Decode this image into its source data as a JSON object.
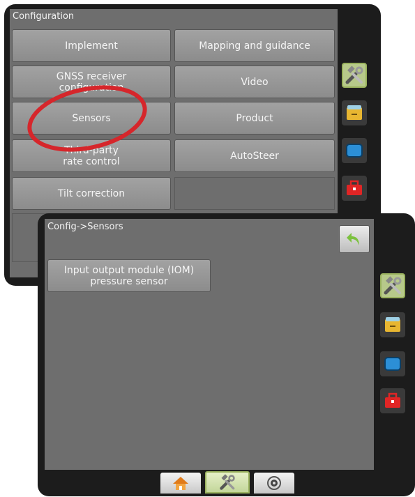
{
  "config_panel": {
    "title": "Configuration",
    "buttons": [
      {
        "label": "Implement"
      },
      {
        "label": "Mapping and guidance"
      },
      {
        "label": "GNSS receiver configuration"
      },
      {
        "label": "Video"
      },
      {
        "label": "Sensors"
      },
      {
        "label": "Product"
      },
      {
        "label": "Third-party rate control"
      },
      {
        "label": "AutoSteer"
      },
      {
        "label": "Tilt correction"
      }
    ]
  },
  "sensors_panel": {
    "breadcrumb": "Config->Sensors",
    "buttons": [
      {
        "label": "Input output module (IOM) pressure sensor"
      }
    ]
  },
  "side_icons": [
    "tools-icon",
    "storage-drawer-icon",
    "display-icon",
    "toolbox-icon"
  ],
  "bottom_tabs": [
    "home-icon",
    "tools-icon",
    "gps-icon"
  ],
  "colors": {
    "accent_green": "#9ab25e",
    "annotation_red": "#d6262b",
    "back_button": "#7cc13f"
  }
}
